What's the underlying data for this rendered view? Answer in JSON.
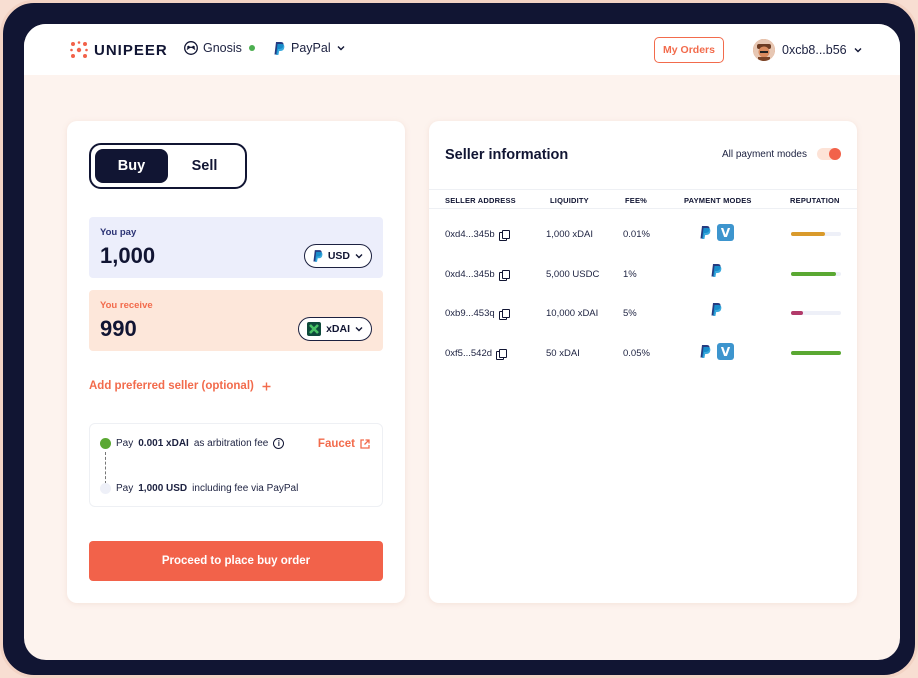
{
  "header": {
    "brand": "UNIPEER",
    "network": "Gnosis",
    "payment_provider": "PayPal",
    "my_orders_label": "My Orders",
    "account": "0xcb8...b56"
  },
  "trade": {
    "tabs": [
      {
        "label": "Buy",
        "active": true
      },
      {
        "label": "Sell",
        "active": false
      }
    ],
    "you_pay": {
      "label": "You pay",
      "value": "1,000",
      "currency": "USD"
    },
    "you_receive": {
      "label": "You receive",
      "value": "990",
      "currency": "xDAI"
    },
    "add_preferred_seller": "Add preferred seller (optional)",
    "steps": {
      "step1_prefix": "Pay",
      "step1_amount": "0.001 xDAI",
      "step1_suffix": "as arbitration fee",
      "step2_prefix": "Pay",
      "step2_amount": "1,000 USD",
      "step2_suffix": "including fee via PayPal",
      "faucet_label": "Faucet"
    },
    "proceed_label": "Proceed to place buy order"
  },
  "sellers": {
    "title": "Seller information",
    "filter_label": "All payment modes",
    "filter_on": true,
    "columns": [
      "SELLER ADDRESS",
      "LIQUIDITY",
      "FEE%",
      "PAYMENT MODES",
      "REPUTATION"
    ],
    "rows": [
      {
        "address": "0xd4...345b",
        "liquidity": "1,000 xDAI",
        "fee": "0.01%",
        "modes": [
          "paypal",
          "venmo"
        ],
        "reputation": 0.68,
        "rep_color": "#d99a2b"
      },
      {
        "address": "0xd4...345b",
        "liquidity": "5,000 USDC",
        "fee": "1%",
        "modes": [
          "paypal"
        ],
        "reputation": 0.9,
        "rep_color": "#5aa832"
      },
      {
        "address": "0xb9...453q",
        "liquidity": "10,000 xDAI",
        "fee": "5%",
        "modes": [
          "paypal"
        ],
        "reputation": 0.24,
        "rep_color": "#b23a6a"
      },
      {
        "address": "0xf5...542d",
        "liquidity": "50 xDAI",
        "fee": "0.05%",
        "modes": [
          "paypal",
          "venmo"
        ],
        "reputation": 1.0,
        "rep_color": "#5aa832"
      }
    ]
  },
  "colors": {
    "accent": "#f2624a",
    "navy": "#111533",
    "pay_bg": "#eceefb",
    "receive_bg": "#fde7da"
  },
  "icons": {
    "brand_logo": "unipeer-logo-icon",
    "network": "gnosis-icon",
    "paypal": "paypal-icon",
    "venmo": "venmo-icon",
    "copy": "copy-icon",
    "info": "info-icon",
    "external": "external-link-icon",
    "plus": "plus-icon",
    "chevron": "chevron-down-icon"
  }
}
